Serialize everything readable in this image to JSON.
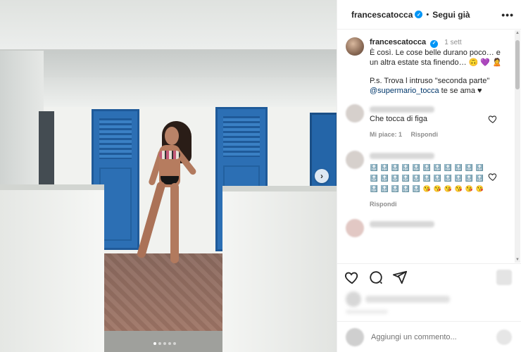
{
  "post": {
    "username": "francescatocca",
    "follow_label": "Segui già",
    "separator": "•",
    "more_label": "•••",
    "carousel_next_label": "›",
    "carousel": {
      "total": 5,
      "current": 1
    }
  },
  "caption": {
    "username": "francescatocca",
    "time": "1 sett",
    "line1": "È così. Le cose belle durano poco… e un altra estate sta finendo… 🙃 💜 🙎",
    "line2": "P.s. Trova l intruso \"seconda parte\"",
    "mention": "@supermario_tocca",
    "line2_tail": " te se ama ♥"
  },
  "comments": [
    {
      "text": "Che tocca di figa",
      "likes_label": "Mi piace: 1",
      "reply_label": "Rispondi"
    },
    {
      "emoji_rows": [
        [
          "🔝",
          "🔝",
          "🔝",
          "🔝",
          "🔝",
          "🔝",
          "🔝",
          "🔝",
          "🔝",
          "🔝",
          "🔝"
        ],
        [
          "🔝",
          "🔝",
          "🔝",
          "🔝",
          "🔝",
          "🔝",
          "🔝",
          "🔝",
          "🔝",
          "🔝",
          "🔝"
        ],
        [
          "🔝",
          "🔝",
          "🔝",
          "🔝",
          "🔝",
          "😘",
          "😘",
          "😘",
          "😘",
          "😘",
          "😘"
        ]
      ],
      "reply_label": "Rispondi"
    }
  ],
  "add_comment": {
    "placeholder": "Aggiungi un commento..."
  },
  "colors": {
    "verified": "#0095f6",
    "door_blue": "#2c6fb4",
    "mention": "#00376b"
  }
}
